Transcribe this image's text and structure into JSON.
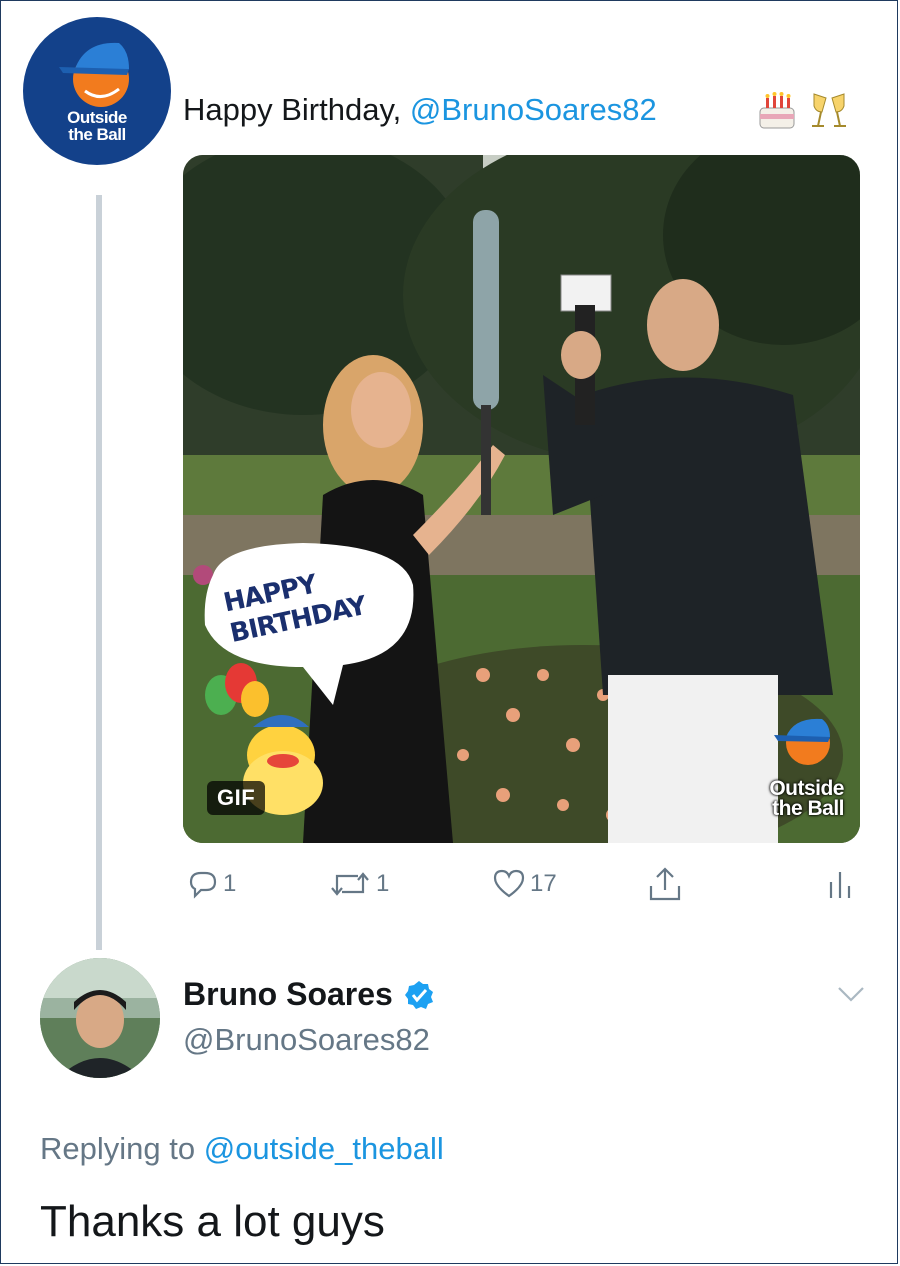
{
  "tweet1": {
    "avatar_text_line1": "Outside",
    "avatar_text_line2": "the Ball",
    "text_prefix": "Happy Birthday, ",
    "mention": "@BrunoSoares82",
    "emojis": [
      "birthday-cake",
      "champagne-glasses"
    ],
    "media": {
      "badge": "GIF",
      "sticker_line1": "HAPPY",
      "sticker_line2": "BIRTHDAY",
      "watermark_line1": "Outside",
      "watermark_line2": "the Ball"
    },
    "actions": {
      "reply_count": "1",
      "retweet_count": "1",
      "like_count": "17"
    }
  },
  "tweet2": {
    "name": "Bruno Soares",
    "handle": "@BrunoSoares82",
    "replying_prefix": "Replying to ",
    "replying_handle": "@outside_theball",
    "text": "Thanks a lot guys"
  },
  "colors": {
    "link": "#1b95e0",
    "muted": "#657786",
    "brand_blue": "#13418a",
    "brand_orange": "#f27b1e"
  }
}
